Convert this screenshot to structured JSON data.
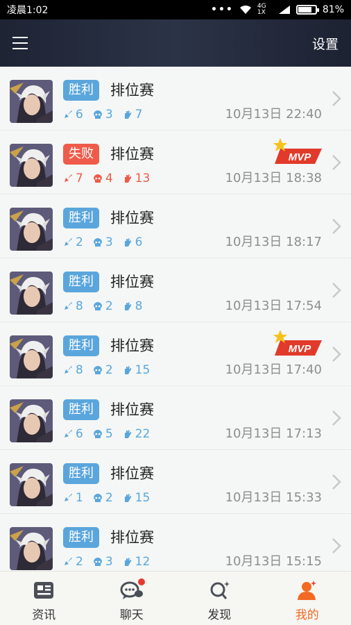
{
  "status_bar": {
    "time": "凌晨1:02",
    "network": "4G 1X",
    "battery": "81%",
    "battery_level": 0.81
  },
  "header": {
    "settings_label": "设置"
  },
  "colors": {
    "win": "#5aa6dc",
    "lose": "#ee5b4a",
    "accent": "#f36a24"
  },
  "matches": [
    {
      "result": "胜利",
      "outcome": "win",
      "mode": "排位赛",
      "kills": "6",
      "deaths": "3",
      "assists": "7",
      "datetime": "10月13日 22:40",
      "mvp": false
    },
    {
      "result": "失败",
      "outcome": "lose",
      "mode": "排位赛",
      "kills": "7",
      "deaths": "4",
      "assists": "13",
      "datetime": "10月13日 18:38",
      "mvp": true
    },
    {
      "result": "胜利",
      "outcome": "win",
      "mode": "排位赛",
      "kills": "2",
      "deaths": "3",
      "assists": "6",
      "datetime": "10月13日 18:17",
      "mvp": false
    },
    {
      "result": "胜利",
      "outcome": "win",
      "mode": "排位赛",
      "kills": "8",
      "deaths": "2",
      "assists": "8",
      "datetime": "10月13日 17:54",
      "mvp": false
    },
    {
      "result": "胜利",
      "outcome": "win",
      "mode": "排位赛",
      "kills": "8",
      "deaths": "2",
      "assists": "15",
      "datetime": "10月13日 17:40",
      "mvp": true
    },
    {
      "result": "胜利",
      "outcome": "win",
      "mode": "排位赛",
      "kills": "6",
      "deaths": "5",
      "assists": "22",
      "datetime": "10月13日 17:13",
      "mvp": false
    },
    {
      "result": "胜利",
      "outcome": "win",
      "mode": "排位赛",
      "kills": "1",
      "deaths": "2",
      "assists": "15",
      "datetime": "10月13日 15:33",
      "mvp": false
    },
    {
      "result": "胜利",
      "outcome": "win",
      "mode": "排位赛",
      "kills": "2",
      "deaths": "3",
      "assists": "12",
      "datetime": "10月13日 15:15",
      "mvp": false
    }
  ],
  "mvp_label": "MVP",
  "tabs": [
    {
      "label": "资讯",
      "icon": "news-icon",
      "active": false,
      "dot": false
    },
    {
      "label": "聊天",
      "icon": "chat-icon",
      "active": false,
      "dot": true
    },
    {
      "label": "发现",
      "icon": "discover-icon",
      "active": false,
      "dot": false
    },
    {
      "label": "我的",
      "icon": "profile-icon",
      "active": true,
      "dot": false
    }
  ]
}
